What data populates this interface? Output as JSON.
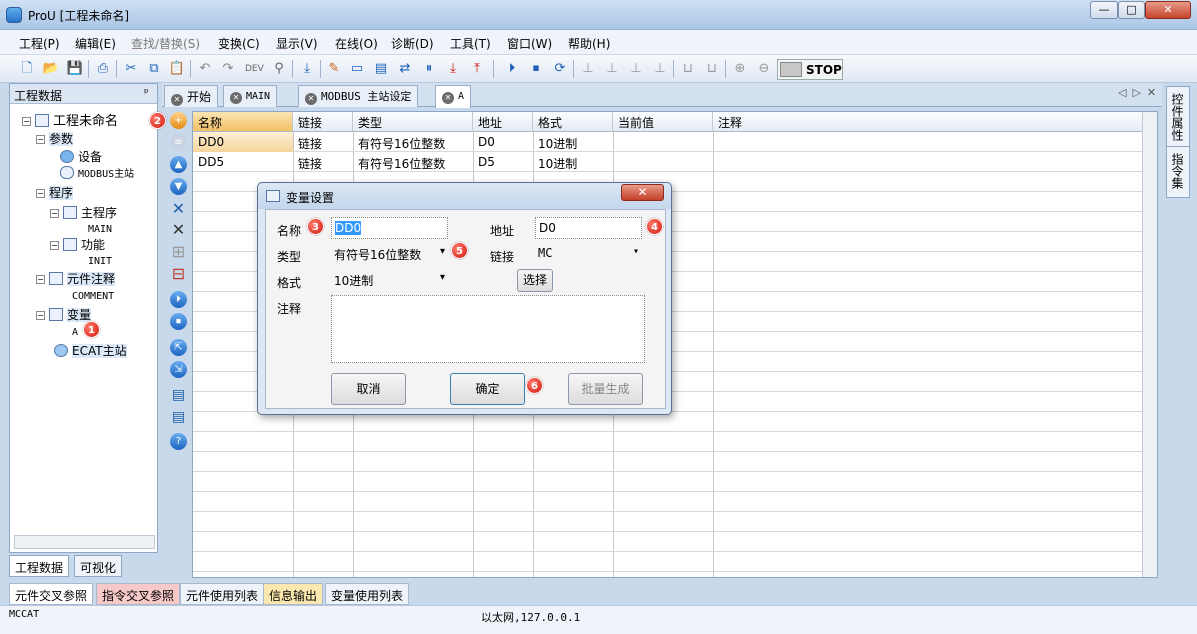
{
  "window": {
    "title": "ProU [工程未命名]",
    "min": "—",
    "max": "□",
    "close": "✕"
  },
  "menu": [
    "工程(P)",
    "编辑(E)",
    "查找/替换(S)",
    "变换(C)",
    "显示(V)",
    "在线(O)",
    "诊断(D)",
    "工具(T)",
    "窗口(W)",
    "帮助(H)"
  ],
  "toolbar": {
    "stop_label": "STOP"
  },
  "left_panel": {
    "title": "工程数据",
    "pin": "ᵖ",
    "tree": {
      "root": "工程未命名",
      "params": "参数",
      "device": "设备",
      "modbus_master": "MODBUS主站",
      "program": "程序",
      "main_program": "主程序",
      "main": "MAIN",
      "function": "功能",
      "init": "INIT",
      "element_comment": "元件注释",
      "comment": "COMMENT",
      "variable": "变量",
      "var_a": "A",
      "ecat_master": "ECAT主站"
    },
    "tabs": [
      "工程数据",
      "可视化"
    ]
  },
  "doc_tabs": [
    "开始",
    "MAIN",
    "MODBUS 主站设定",
    "A"
  ],
  "grid": {
    "headers": [
      "名称",
      "链接",
      "类型",
      "地址",
      "格式",
      "当前值",
      "注释"
    ],
    "rows": [
      [
        "DD0",
        "链接",
        "有符号16位整数",
        "D0",
        "10进制",
        "",
        ""
      ],
      [
        "DD5",
        "链接",
        "有符号16位整数",
        "D5",
        "10进制",
        "",
        ""
      ]
    ]
  },
  "right_tabs": [
    "控件属性",
    "指令集"
  ],
  "bottom_tabs": [
    "元件交叉参照",
    "指令交叉参照",
    "元件使用列表",
    "信息输出",
    "变量使用列表"
  ],
  "status": {
    "left": "MCCAT",
    "center": "以太网,127.0.0.1"
  },
  "dialog": {
    "title": "变量设置",
    "name_label": "名称",
    "name_value": "DD0",
    "address_label": "地址",
    "address_value": "D0",
    "type_label": "类型",
    "type_value": "有符号16位整数",
    "link_label": "链接",
    "link_value": "MC",
    "format_label": "格式",
    "format_value": "10进制",
    "select_button": "选择",
    "comment_label": "注释",
    "comment_value": "",
    "cancel": "取消",
    "ok": "确定",
    "batch": "批量生成"
  },
  "badges": [
    "1",
    "2",
    "3",
    "4",
    "5",
    "6"
  ],
  "colors": {
    "badge": "#d0160b",
    "selected_header": "#f2c166",
    "accent": "#1d64c0"
  }
}
